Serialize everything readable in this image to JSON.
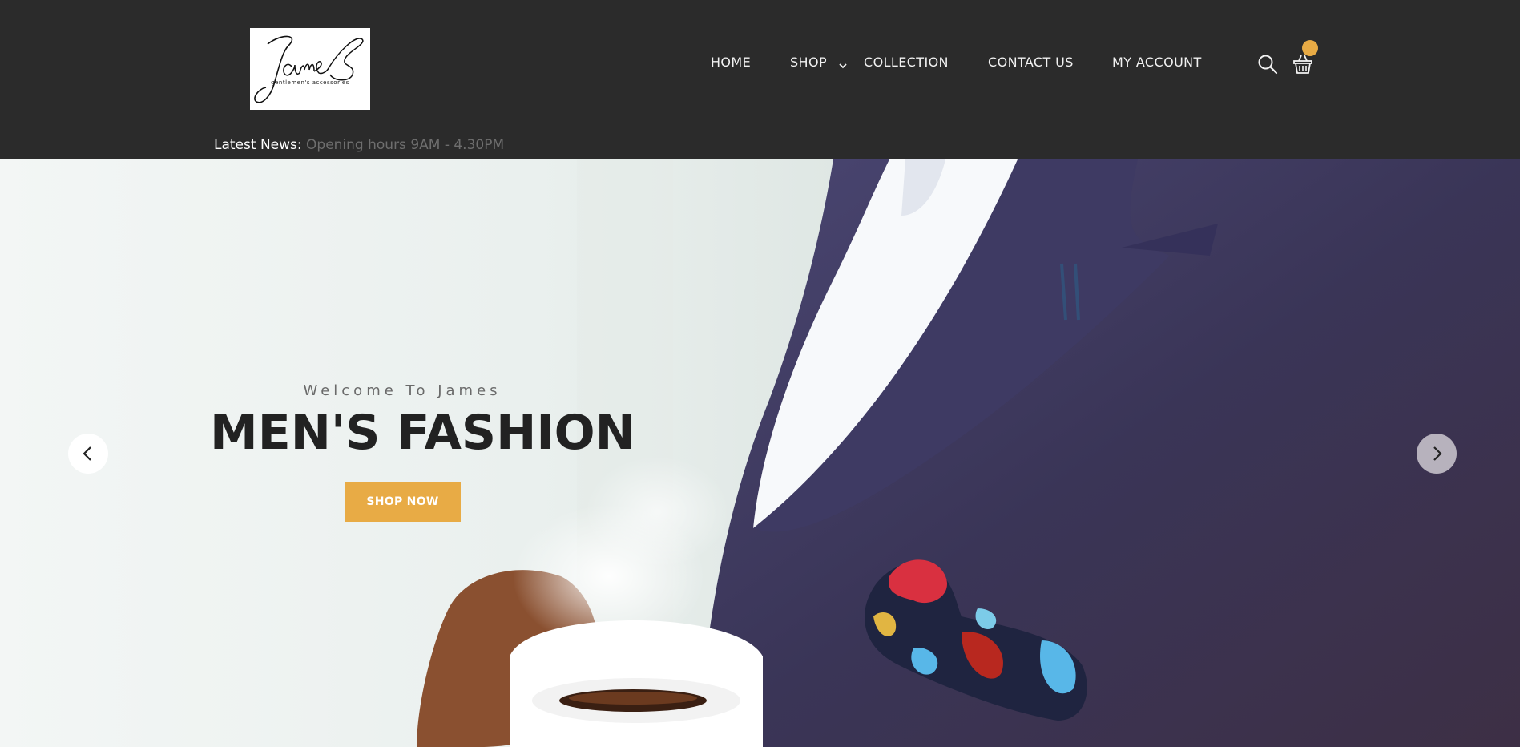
{
  "brand": {
    "logo_script": "James",
    "tagline": "gentlemen's accessories"
  },
  "nav": {
    "items": [
      {
        "label": "HOME"
      },
      {
        "label": "SHOP"
      },
      {
        "label": "COLLECTION"
      },
      {
        "label": "CONTACT US"
      },
      {
        "label": "MY ACCOUNT"
      }
    ]
  },
  "icons": {
    "search": "search-icon",
    "cart": "basket-icon",
    "shop_dropdown": "chevron-down-icon",
    "prev": "chevron-left-icon",
    "next": "chevron-right-icon"
  },
  "cart": {
    "badge_count": ""
  },
  "news": {
    "label": "Latest News:",
    "text": "Opening hours 9AM - 4.30PM"
  },
  "hero": {
    "welcome": "Welcome To James",
    "headline": "MEN'S FASHION",
    "cta_label": "SHOP NOW"
  },
  "colors": {
    "header_bg": "#2b2b2b",
    "accent": "#e8ab45",
    "headline": "#222222",
    "suit": "#3a3557"
  }
}
